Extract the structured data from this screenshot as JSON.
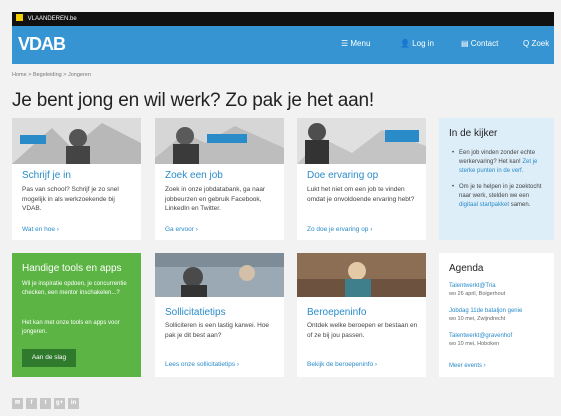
{
  "topbar": {
    "site": "VLAANDEREN.be"
  },
  "nav": {
    "logo": "VDAB",
    "menu": "☰ Menu",
    "login": "👤 Log in",
    "contact": "▤ Contact",
    "search": "Q Zoek"
  },
  "breadcrumb": "Home  >  Begeleiding  >  Jongeren",
  "page_title": "Je bent jong en wil werk? Zo pak je het aan!",
  "cards": [
    {
      "title": "Schrijf je in",
      "text": "Pas van school? Schrijf je zo snel mogelijk in als werkzoekende bij VDAB.",
      "link": "Wat en hoe  ›"
    },
    {
      "title": "Zoek een job",
      "text": "Zoek in onze jobdatabank, ga naar jobbeurzen en gebruik Facebook, LinkedIn en Twitter.",
      "link": "Ga ervoor  ›"
    },
    {
      "title": "Doe ervaring op",
      "text": "Lukt het niet om een job te vinden omdat je onvoldoende ervaring hebt?",
      "link": "Zo doe je ervaring op  ›"
    },
    {
      "title": "Sollicitatietips",
      "text": "Solliciteren is een lastig karwei. Hoe pak je dit best aan?",
      "link": "Lees onze sollicitatietips  ›"
    },
    {
      "title": "Beroepeninfo",
      "text": "Ontdek welke beroepen er bestaan en of ze bij jou passen.",
      "link": "Bekijk de beroepeninfo  ›"
    }
  ],
  "kijker": {
    "title": "In de kijker",
    "item1_text": "Een job vinden zonder echte werkervaring? Het kan! ",
    "item1_link": "Zet je sterke punten in de verf.",
    "item2_text": "Om je te helpen in je zoektocht naar werk, stelden we een ",
    "item2_link": "digitaal startpakket",
    "item2_end": " samen."
  },
  "tools": {
    "title": "Handige tools en apps",
    "p1": "Wil je inspiratie opdoen, je concurrentie checken, een mentor inschakelen...?",
    "p2": "Het kan met onze tools en apps voor jongeren.",
    "button": "Aan de slag"
  },
  "agenda": {
    "title": "Agenda",
    "events": [
      {
        "name": "Talentwerkt@Tria",
        "date": "wo 26 april, Boigerhout"
      },
      {
        "name": "Jobdag 11de bataljon genie",
        "date": "wo 10 mei, Zwijndrecht"
      },
      {
        "name": "Talentwerkt@gravenhof",
        "date": "wo 10 mei, Hoboken"
      }
    ],
    "more": "Meer events  ›"
  },
  "social": [
    "✉",
    "f",
    "t",
    "g+",
    "in"
  ],
  "colors": {
    "nav": "#3594d1",
    "link": "#2a8bc9",
    "green": "#5bb443",
    "kijker_bg": "#ddeef9"
  }
}
